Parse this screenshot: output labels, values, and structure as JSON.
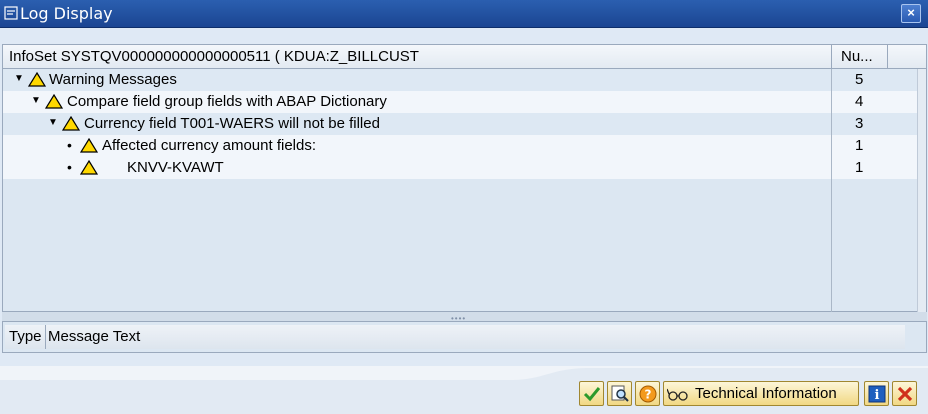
{
  "window": {
    "title": "Log Display",
    "close_glyph": "×"
  },
  "tree": {
    "columns": [
      "InfoSet SYSTQV000000000000000511 ( KDUA:Z_BILLCUST",
      "Nu..."
    ],
    "rows": [
      {
        "label": "Warning Messages",
        "count": "5",
        "level": 0,
        "expandable": true,
        "icon": "warning-icon"
      },
      {
        "label": "Compare field group fields with ABAP Dictionary",
        "count": "4",
        "level": 1,
        "expandable": true,
        "icon": "warning-icon"
      },
      {
        "label": "Currency field T001-WAERS will not be filled",
        "count": "3",
        "level": 2,
        "expandable": true,
        "icon": "warning-icon"
      },
      {
        "label": "Affected currency amount fields:",
        "count": "1",
        "level": 3,
        "expandable": false,
        "icon": "warning-icon"
      },
      {
        "label": "      KNVV-KVAWT",
        "count": "1",
        "level": 3,
        "expandable": false,
        "icon": "warning-icon"
      }
    ]
  },
  "detail": {
    "columns": [
      "Type",
      "Message Text"
    ]
  },
  "footer": {
    "buttons": [
      {
        "name": "continue-button",
        "icon": "checkmark-icon",
        "label": ""
      },
      {
        "name": "find-button",
        "icon": "magnifier-icon",
        "label": ""
      },
      {
        "name": "help-button",
        "icon": "help-icon",
        "label": ""
      },
      {
        "name": "technical-information-button",
        "icon": "glasses-icon",
        "label": "Technical Information"
      },
      {
        "name": "info-button",
        "icon": "info-icon",
        "label": ""
      },
      {
        "name": "cancel-button",
        "icon": "cancel-icon",
        "label": ""
      }
    ]
  },
  "colors": {
    "titlebar": "#1b4592",
    "panel": "#dce7f2",
    "button": "#f1d883",
    "warning": "#ffd800"
  }
}
